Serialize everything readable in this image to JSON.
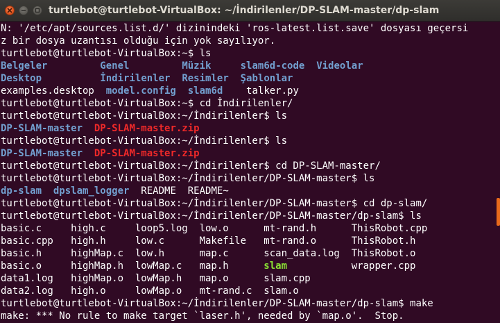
{
  "window": {
    "title": "turtlebot@turtlebot-VirtualBox: ~/İndirilenler/DP-SLAM-master/dp-slam"
  },
  "colors": {
    "background": "#300a24",
    "text": "#ffffff",
    "directory": "#729fcf",
    "archive": "#ef2929",
    "executable": "#8ae234",
    "accent": "#e86a1b"
  },
  "terminal": {
    "lines": [
      [
        {
          "t": "N: '/etc/apt/sources.list.d/' dizinindeki 'ros-latest.list.save' dosyası geçersi"
        }
      ],
      [
        {
          "t": "z bir dosya uzantısı olduğu için yok sayılıyor."
        }
      ],
      [
        {
          "t": "turtlebot@turtlebot-VirtualBox:~$ ls"
        }
      ],
      [
        {
          "t": "Belgeler",
          "c": "dir"
        },
        {
          "t": "         "
        },
        {
          "t": "Genel",
          "c": "dir"
        },
        {
          "t": "         "
        },
        {
          "t": "Müzik",
          "c": "dir"
        },
        {
          "t": "     "
        },
        {
          "t": "slam6d-code",
          "c": "dir"
        },
        {
          "t": "  "
        },
        {
          "t": "Videolar",
          "c": "dir"
        }
      ],
      [
        {
          "t": "Desktop",
          "c": "dir"
        },
        {
          "t": "          "
        },
        {
          "t": "İndirilenler",
          "c": "dir"
        },
        {
          "t": "  "
        },
        {
          "t": "Resimler",
          "c": "dir"
        },
        {
          "t": "  "
        },
        {
          "t": "Şablonlar",
          "c": "dir"
        }
      ],
      [
        {
          "t": "examples.desktop  "
        },
        {
          "t": "model.config",
          "c": "dir"
        },
        {
          "t": "  "
        },
        {
          "t": "slam6d",
          "c": "dir"
        },
        {
          "t": "    talker.py"
        }
      ],
      [
        {
          "t": "turtlebot@turtlebot-VirtualBox:~$ cd İndirilenler/"
        }
      ],
      [
        {
          "t": "turtlebot@turtlebot-VirtualBox:~/İndirilenler$ ls"
        }
      ],
      [
        {
          "t": "DP-SLAM-master",
          "c": "dir"
        },
        {
          "t": "  "
        },
        {
          "t": "DP-SLAM-master.zip",
          "c": "zip"
        }
      ],
      [
        {
          "t": "turtlebot@turtlebot-VirtualBox:~/İndirilenler$ ls"
        }
      ],
      [
        {
          "t": "DP-SLAM-master",
          "c": "dir"
        },
        {
          "t": "  "
        },
        {
          "t": "DP-SLAM-master.zip",
          "c": "zip"
        }
      ],
      [
        {
          "t": "turtlebot@turtlebot-VirtualBox:~/İndirilenler$ cd DP-SLAM-master/"
        }
      ],
      [
        {
          "t": "turtlebot@turtlebot-VirtualBox:~/İndirilenler/DP-SLAM-master$ ls"
        }
      ],
      [
        {
          "t": "dp-slam",
          "c": "dir"
        },
        {
          "t": "  "
        },
        {
          "t": "dpslam_logger",
          "c": "dir"
        },
        {
          "t": "  README  README~"
        }
      ],
      [
        {
          "t": "turtlebot@turtlebot-VirtualBox:~/İndirilenler/DP-SLAM-master$ cd dp-slam/"
        }
      ],
      [
        {
          "t": "turtlebot@turtlebot-VirtualBox:~/İndirilenler/DP-SLAM-master/dp-slam$ ls"
        }
      ],
      [
        {
          "t": "basic.c     high.c     loop5.log  low.o      mt-rand.h      ThisRobot.cpp"
        }
      ],
      [
        {
          "t": "basic.cpp   high.h     low.c      Makefile   mt-rand.o      ThisRobot.h"
        }
      ],
      [
        {
          "t": "basic.h     highMap.c  low.h      map.c      scan_data.log  ThisRobot.o"
        }
      ],
      [
        {
          "t": "basic.o     highMap.h  lowMap.c   map.h      "
        },
        {
          "t": "slam",
          "c": "exe"
        },
        {
          "t": "           wrapper.cpp"
        }
      ],
      [
        {
          "t": "data1.log   highMap.o  lowMap.h   map.o      slam.cpp"
        }
      ],
      [
        {
          "t": "data2.log   high.o     lowMap.o   mt-rand.c  slam.o"
        }
      ],
      [
        {
          "t": "turtlebot@turtlebot-VirtualBox:~/İndirilenler/DP-SLAM-master/dp-slam$ make"
        }
      ],
      [
        {
          "t": "make: *** No rule to make target `laser.h', needed by `map.o'.  Stop."
        }
      ]
    ]
  }
}
